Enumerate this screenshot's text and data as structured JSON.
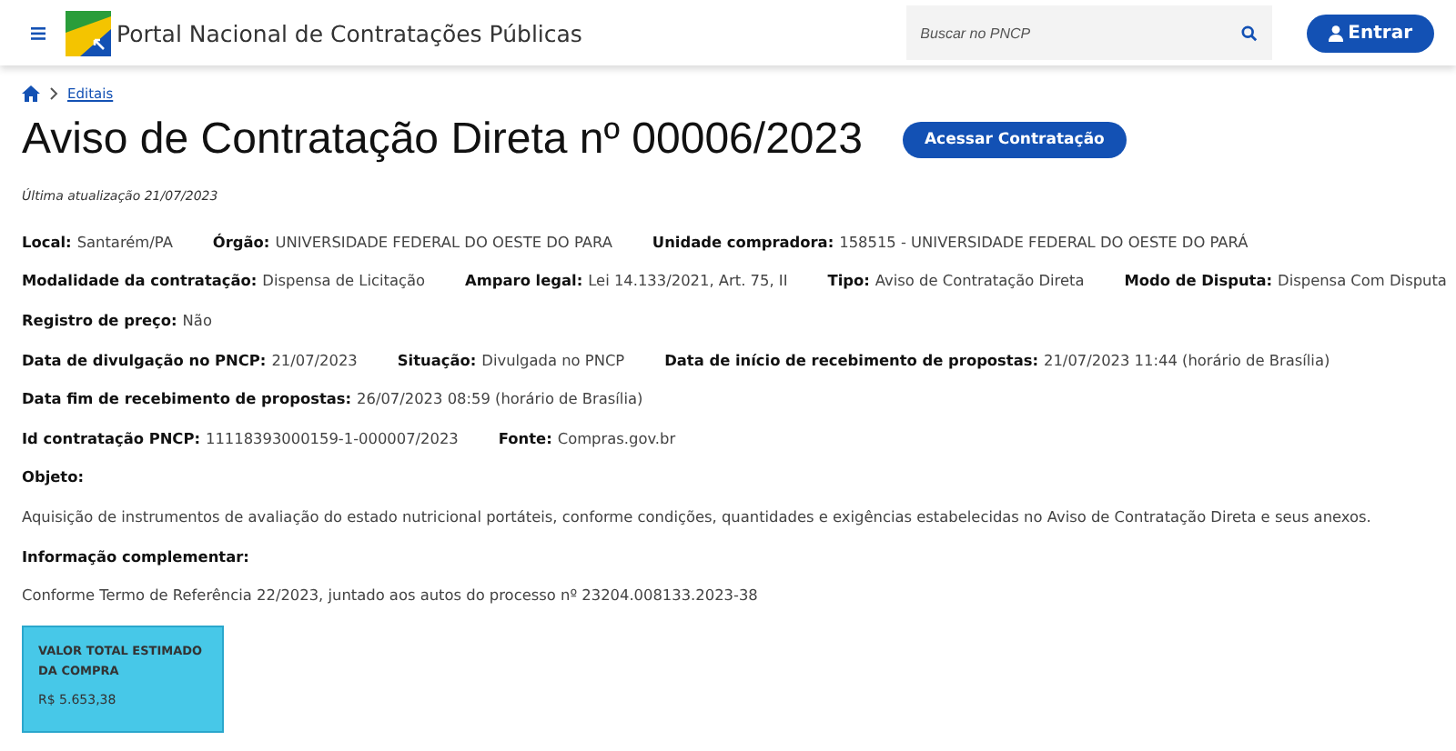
{
  "header": {
    "title": "Portal Nacional de Contratações Públicas",
    "search": {
      "placeholder": "Buscar no PNCP"
    },
    "login_button": "Entrar"
  },
  "breadcrumb": [
    "Editais"
  ],
  "page": {
    "title": "Aviso de Contratação Direta nº 00006/2023",
    "action_button": "Acessar Contratação",
    "updated": "Última atualização 21/07/2023"
  },
  "field_rows": [
    [
      {
        "label": "Local:",
        "value": "Santarém/PA"
      },
      {
        "label": "Órgão:",
        "value": "UNIVERSIDADE FEDERAL DO OESTE DO PARA"
      },
      {
        "label": "Unidade compradora:",
        "value": "158515 - UNIVERSIDADE FEDERAL DO OESTE DO PARÁ"
      }
    ],
    [
      {
        "label": "Modalidade da contratação:",
        "value": "Dispensa de Licitação"
      },
      {
        "label": "Amparo legal:",
        "value": "Lei 14.133/2021, Art. 75, II"
      },
      {
        "label": "Tipo:",
        "value": "Aviso de Contratação Direta"
      },
      {
        "label": "Modo de Disputa:",
        "value": "Dispensa Com Disputa"
      }
    ],
    [
      {
        "label": "Registro de preço:",
        "value": "Não"
      }
    ],
    [
      {
        "label": "Data de divulgação no PNCP:",
        "value": "21/07/2023"
      },
      {
        "label": "Situação:",
        "value": "Divulgada no PNCP"
      },
      {
        "label": "Data de início de recebimento de propostas:",
        "value": "21/07/2023 11:44 (horário de Brasília)"
      }
    ],
    [
      {
        "label": "Data fim de recebimento de propostas:",
        "value": "26/07/2023 08:59 (horário de Brasília)"
      }
    ],
    [
      {
        "label": "Id contratação PNCP:",
        "value": "11118393000159-1-000007/2023"
      },
      {
        "label": "Fonte:",
        "value": "Compras.gov.br"
      }
    ]
  ],
  "sections": [
    {
      "heading": "Objeto:",
      "text": "Aquisição de instrumentos de avaliação do estado nutricional portáteis, conforme condições, quantidades e exigências estabelecidas no Aviso de Contratação Direta e seus anexos."
    },
    {
      "heading": "Informação complementar:",
      "text": "Conforme Termo de Referência 22/2023, juntado aos autos do processo nº 23204.008133.2023-38"
    }
  ],
  "value_card": {
    "label": "VALOR TOTAL ESTIMADO DA COMPRA",
    "value": "R$ 5.653,38"
  }
}
